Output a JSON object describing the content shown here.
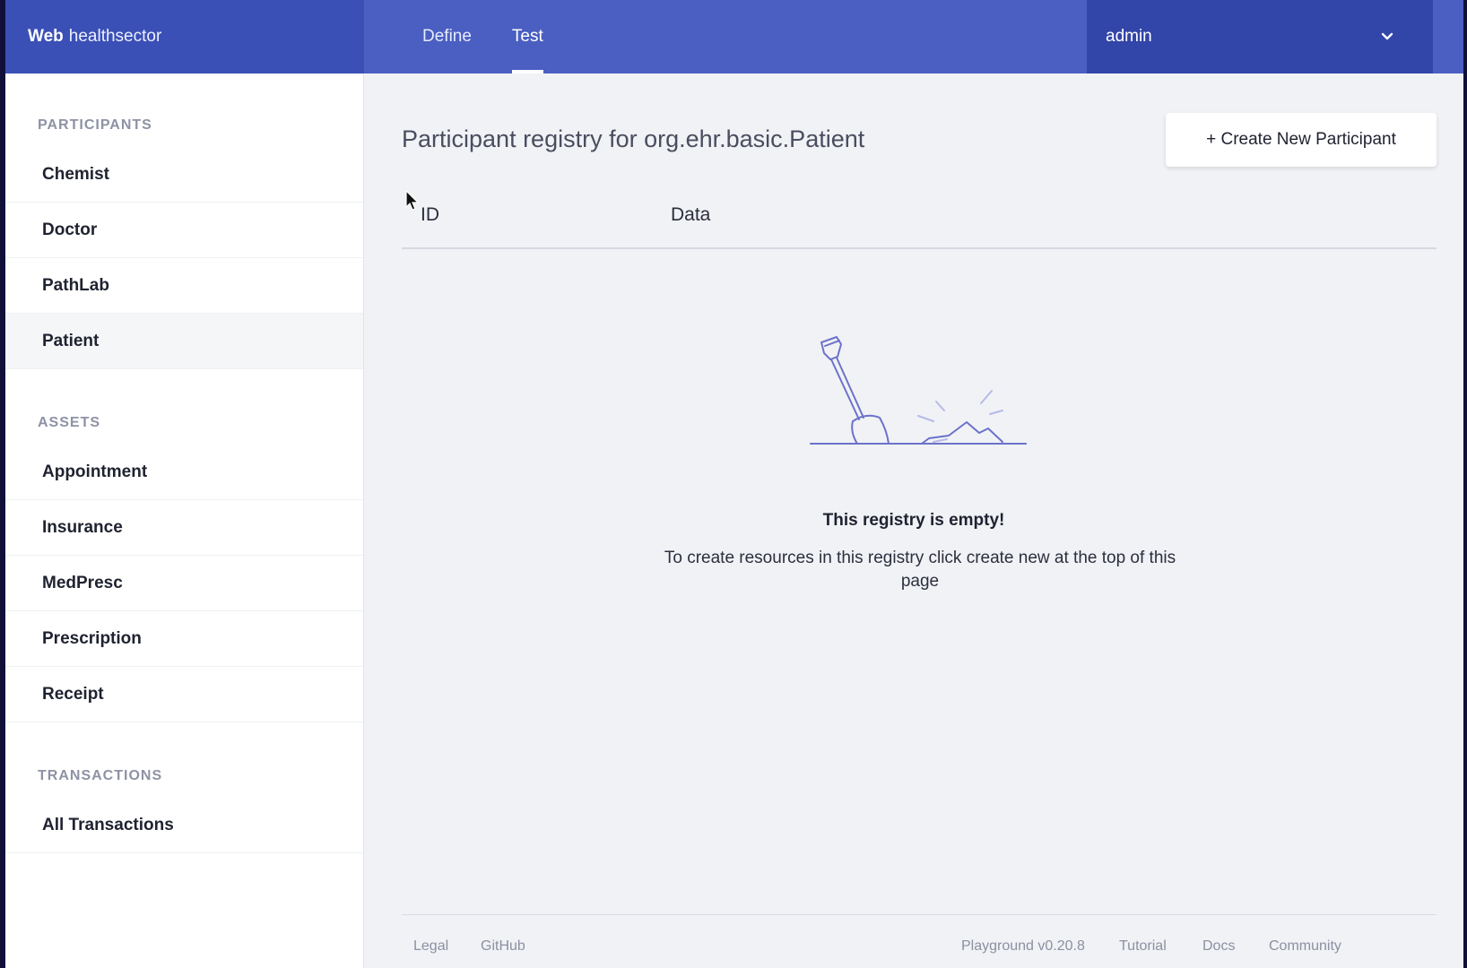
{
  "brand": {
    "bold": "Web",
    "name": "healthsector"
  },
  "nav": {
    "tabs": [
      {
        "label": "Define"
      },
      {
        "label": "Test"
      }
    ]
  },
  "user": {
    "name": "admin"
  },
  "sidebar": {
    "participants_title": "PARTICIPANTS",
    "participants": [
      "Chemist",
      "Doctor",
      "PathLab",
      "Patient"
    ],
    "assets_title": "ASSETS",
    "assets": [
      "Appointment",
      "Insurance",
      "MedPresc",
      "Prescription",
      "Receipt"
    ],
    "transactions_title": "TRANSACTIONS",
    "transactions": [
      "All Transactions"
    ]
  },
  "main": {
    "title": "Participant registry for org.ehr.basic.Patient",
    "create_button": "+ Create New Participant",
    "columns": {
      "id": "ID",
      "data": "Data"
    },
    "empty_title": "This registry is empty!",
    "empty_desc": "To create resources in this registry click create new at the top of this page"
  },
  "footer": {
    "legal": "Legal",
    "github": "GitHub",
    "version": "Playground v0.20.8",
    "tutorial": "Tutorial",
    "docs": "Docs",
    "community": "Community"
  },
  "colors": {
    "topbar": "#4a5fc1",
    "brand_bg": "#3b50b6",
    "user_bg": "#3245a8",
    "illustration": "#6b72c9"
  }
}
